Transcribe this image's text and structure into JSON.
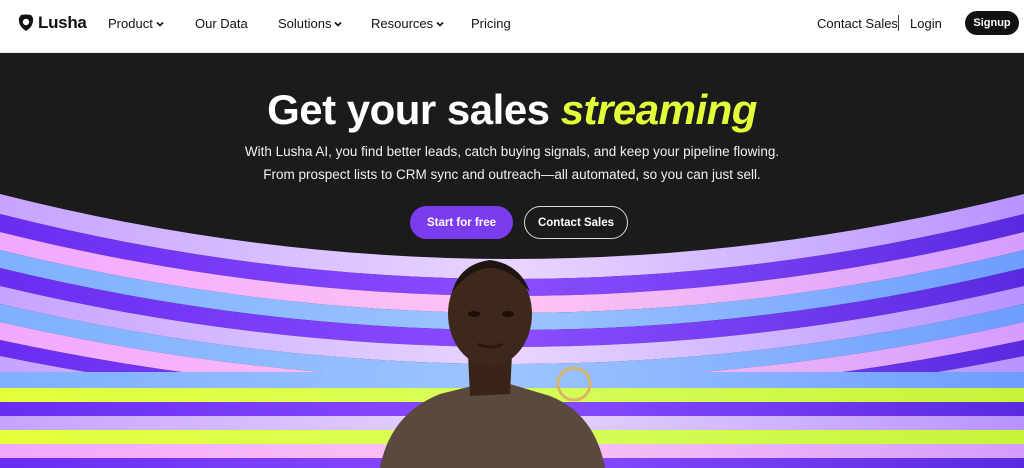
{
  "brand": {
    "name": "Lusha"
  },
  "nav": {
    "product": "Product",
    "our_data": "Our Data",
    "solutions": "Solutions",
    "resources": "Resources",
    "pricing": "Pricing",
    "contact_sales": "Contact Sales",
    "login": "Login",
    "signup": "Signup"
  },
  "hero": {
    "headline_main": "Get your sales",
    "headline_accent": "streaming",
    "sub_line1": "With Lusha AI, you find better leads, catch buying signals, and keep your pipeline flowing.",
    "sub_line2": "From prospect lists to CRM sync and outreach—all automated, so you can just sell.",
    "cta_primary": "Start for free",
    "cta_secondary": "Contact Sales"
  },
  "colors": {
    "accent_yellow": "#e4ff3a",
    "primary_purple": "#7b3cf0",
    "hero_bg": "#1b1b1b"
  },
  "icons": [
    "lusha-logo-icon",
    "chevron-down-icon"
  ]
}
